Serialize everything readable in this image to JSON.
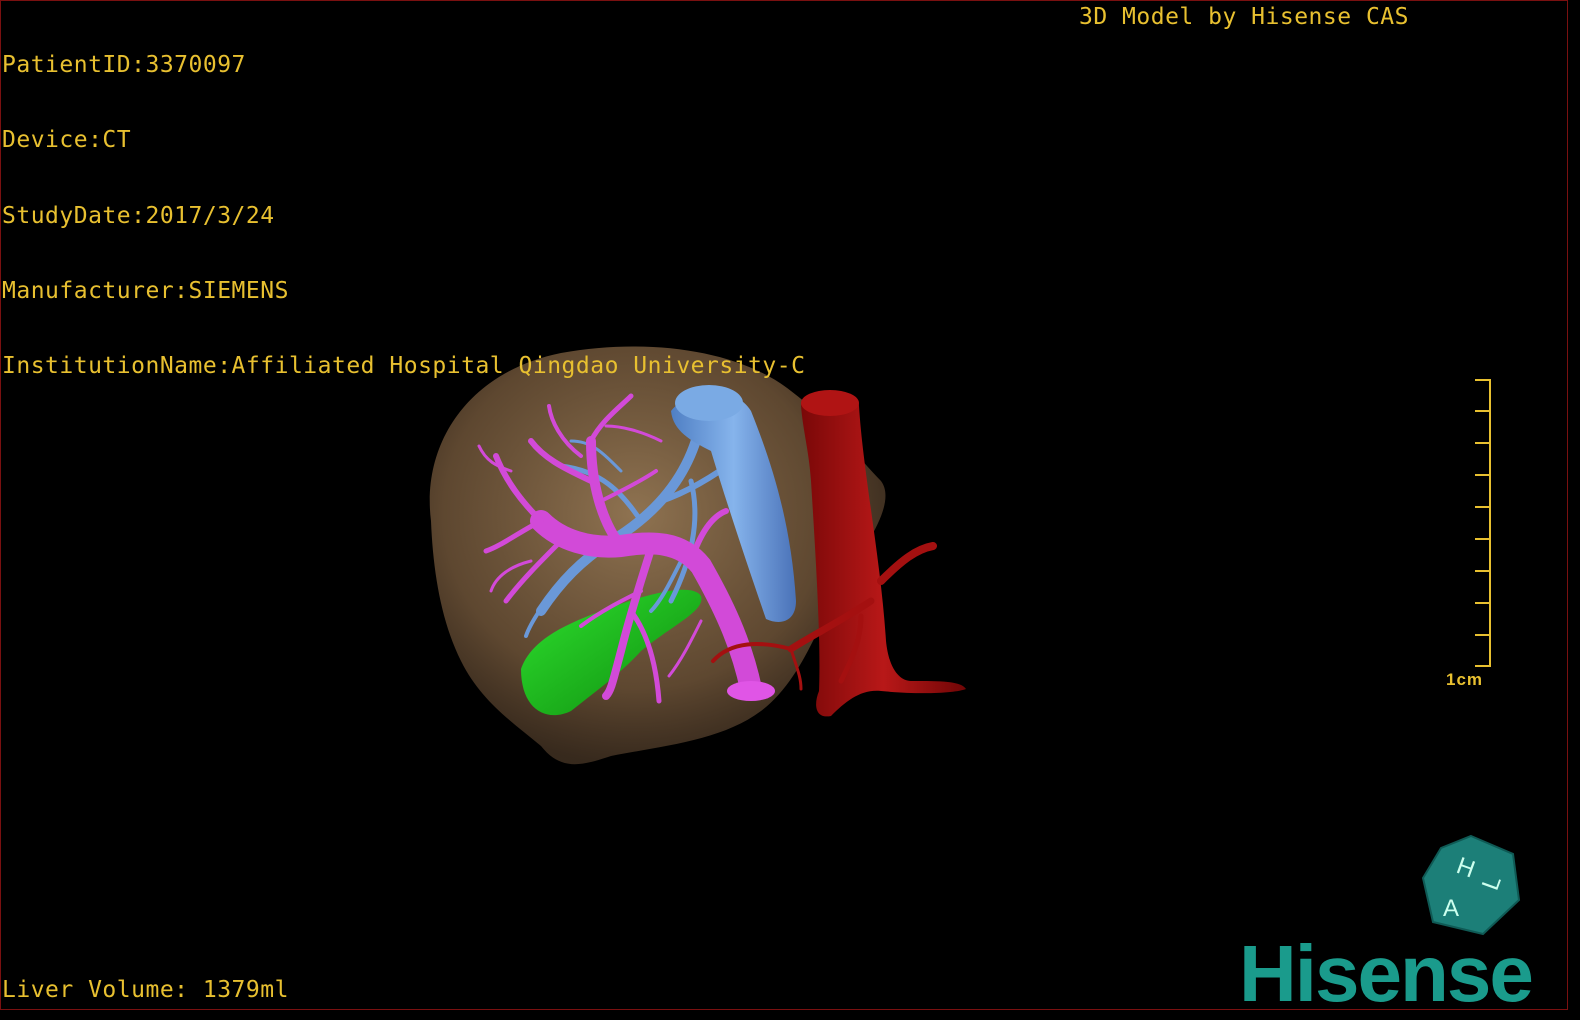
{
  "patient_info": [
    "PatientID:3370097",
    "Device:CT",
    "StudyDate:2017/3/24",
    "Manufacturer:SIEMENS",
    "InstitutionName:Affiliated Hospital Qingdao University-C"
  ],
  "credit": "3D Model by Hisense CAS",
  "liver_volume": "Liver Volume: 1379ml",
  "scale_label": "1cm",
  "orientation_cube": {
    "label_top": "H",
    "label_left": "A",
    "label_right": "L"
  },
  "brand": "Hisense",
  "colors": {
    "overlay_text": "#e8c030",
    "liver": "#8a6a48",
    "hepatic_vein": "#d24ad8",
    "portal_vein": "#6a98d8",
    "vena_cava": "#6aa0e0",
    "aorta": "#a01010",
    "gallbladder": "#1ec01e",
    "brand": "#1a9b8c"
  }
}
